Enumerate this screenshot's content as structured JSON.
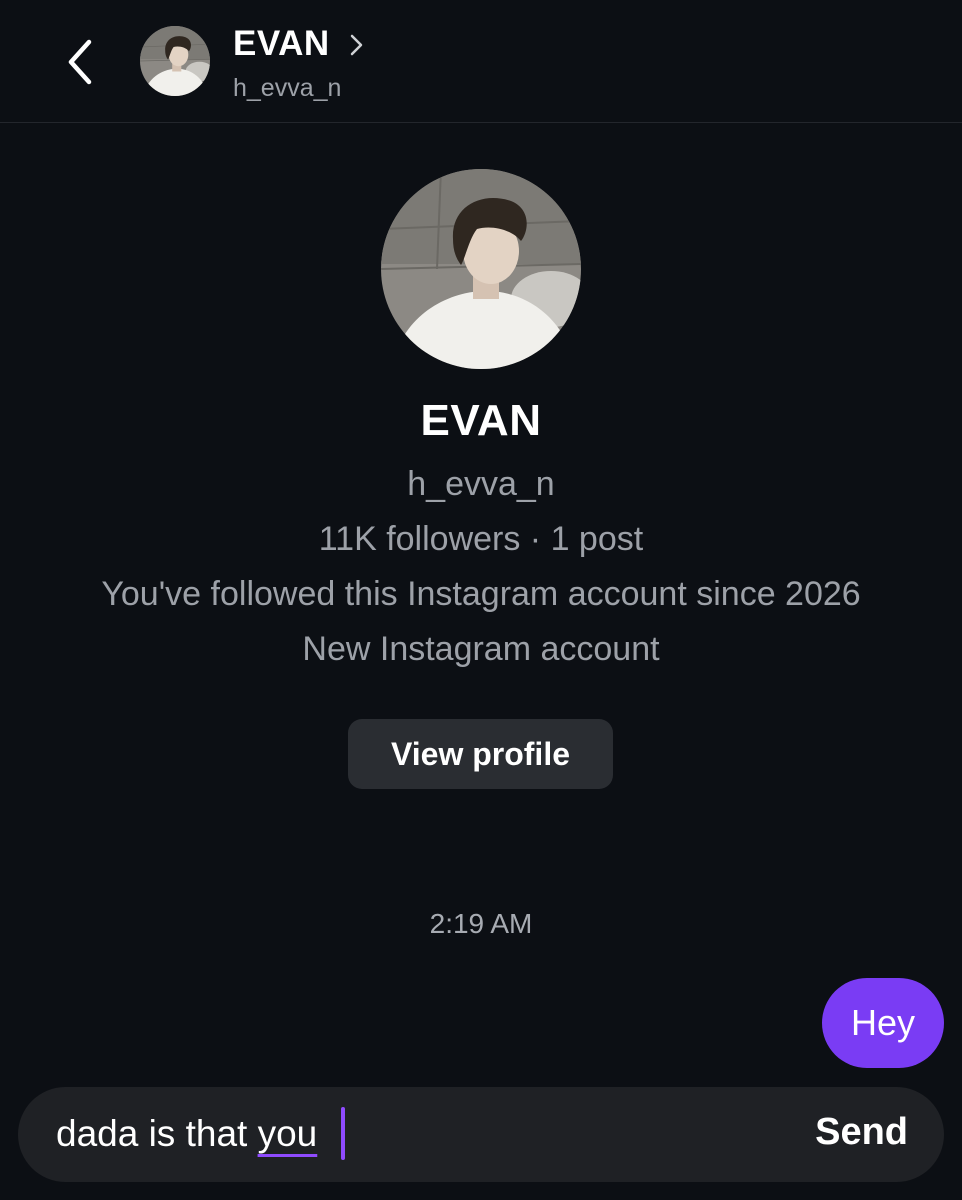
{
  "header": {
    "name": "EVAN",
    "username": "h_evva_n"
  },
  "profile": {
    "name": "EVAN",
    "username": "h_evva_n",
    "stats": "11K followers · 1 post",
    "followed_since": "You've followed this Instagram account since 2026",
    "account_note": "New Instagram account",
    "view_profile_label": "View profile"
  },
  "thread": {
    "timestamp": "2:19 AM",
    "messages": [
      {
        "text": "Hey",
        "sender": "me"
      }
    ]
  },
  "composer": {
    "draft_prefix": "dada is that ",
    "draft_underlined": "you",
    "send_label": "Send"
  },
  "colors": {
    "background": "#0c0f14",
    "bubble": "#7a3cf4",
    "accent": "#8f4bff",
    "secondary_text": "#9da1a8"
  },
  "icons": {
    "back": "chevron-left-icon",
    "header_chevron": "chevron-right-icon"
  }
}
